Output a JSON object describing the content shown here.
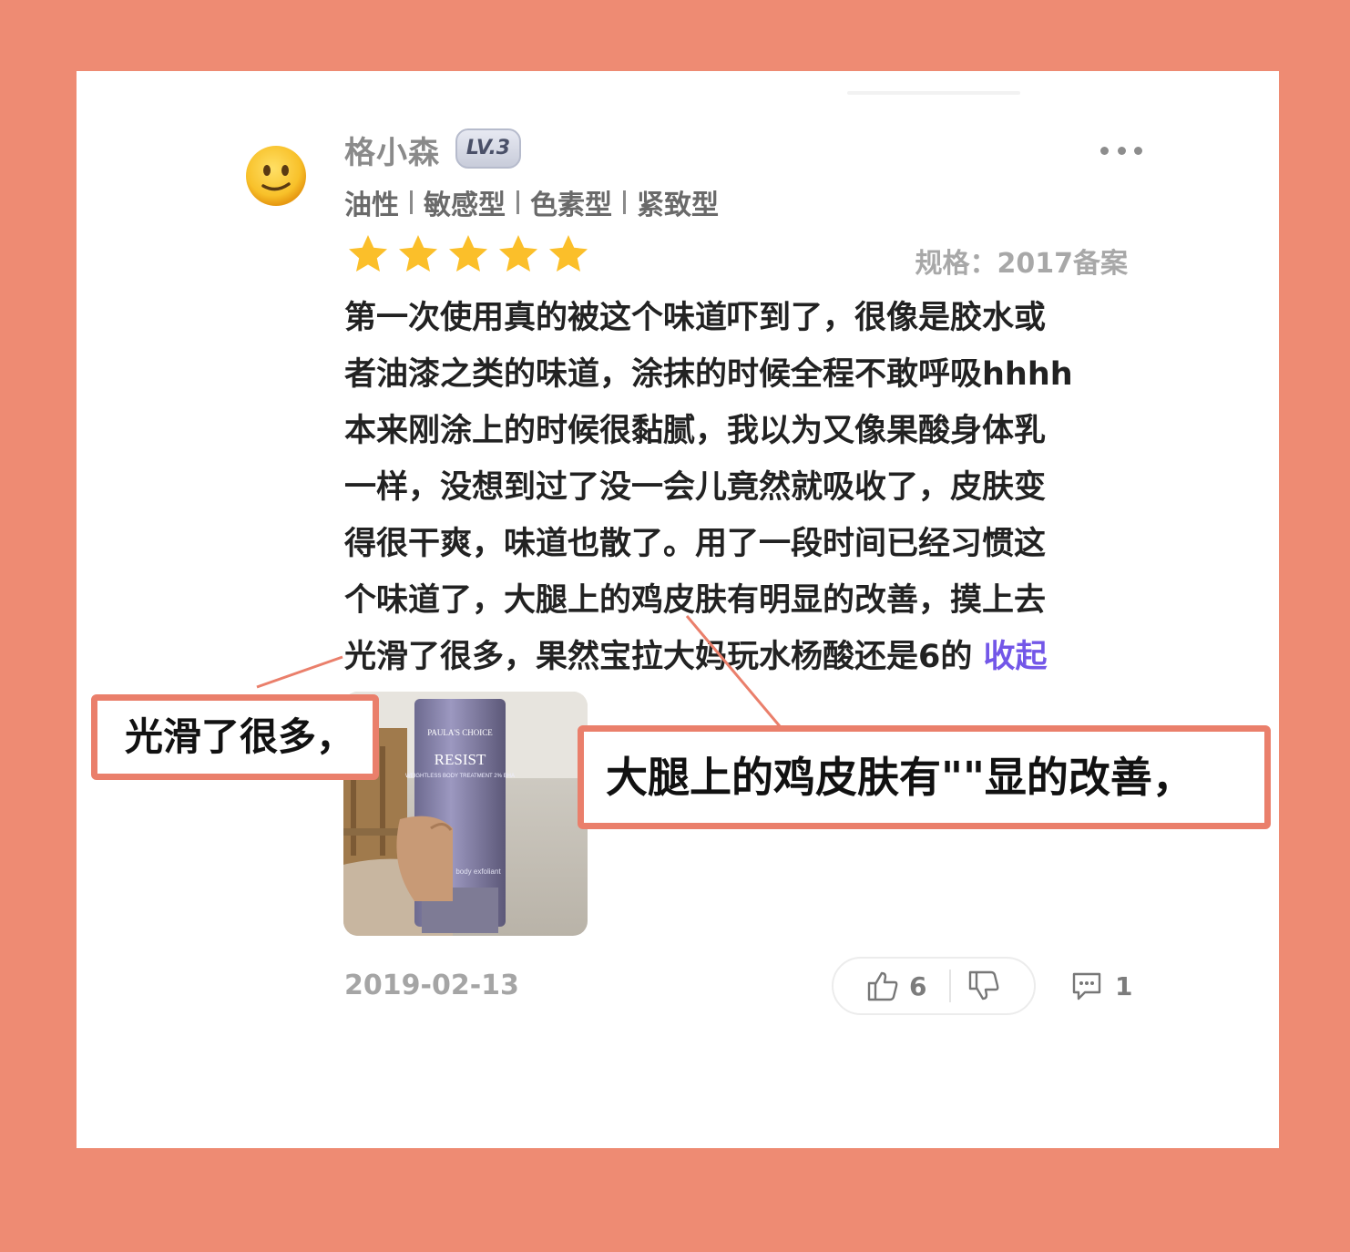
{
  "review": {
    "username": "格小森",
    "level": "LV.3",
    "skin_tags": [
      "油性",
      "敏感型",
      "色素型",
      "紧致型"
    ],
    "rating": 5,
    "rating_max": 5,
    "spec": "规格：2017备案",
    "text_lines": [
      "第一次使用真的被这个味道吓到了，很像是胶水或",
      "者油漆之类的味道，涂抹的时候全程不敢呼吸hhhh",
      "本来刚涂上的时候很黏腻，我以为又像果酸身体乳",
      "一样，没想到过了没一会儿竟然就吸收了，皮肤变",
      "得很干爽，味道也散了。用了一段时间已经习惯这",
      "个味道了，大腿上的鸡皮肤有明显的改善，摸上去",
      "光滑了很多，果然宝拉大妈玩水杨酸还是6的 "
    ],
    "collapse_label": "收起",
    "photo": {
      "brand_text": "PAULA'S CHOICE",
      "product_text": "RESIST",
      "sub_text": "WEIGHTLESS BODY TREATMENT 2% BHA",
      "footer_text": "body exfoliant"
    },
    "date": "2019-02-13",
    "like_count": "6",
    "comment_count": "1"
  },
  "callouts": {
    "left": "光滑了很多，",
    "right": "大腿上的鸡皮肤有\"\"显的改善，"
  },
  "colors": {
    "background": "#ee8b73",
    "callout_border": "#ea7f6b",
    "star": "#fbbf2a",
    "link": "#7357e8"
  },
  "icons": {
    "avatar": "slightly-smiling-face-emoji",
    "more": "more-dots-icon",
    "like": "thumbs-up-icon",
    "dislike": "thumbs-down-icon",
    "comment": "comment-bubble-icon"
  }
}
